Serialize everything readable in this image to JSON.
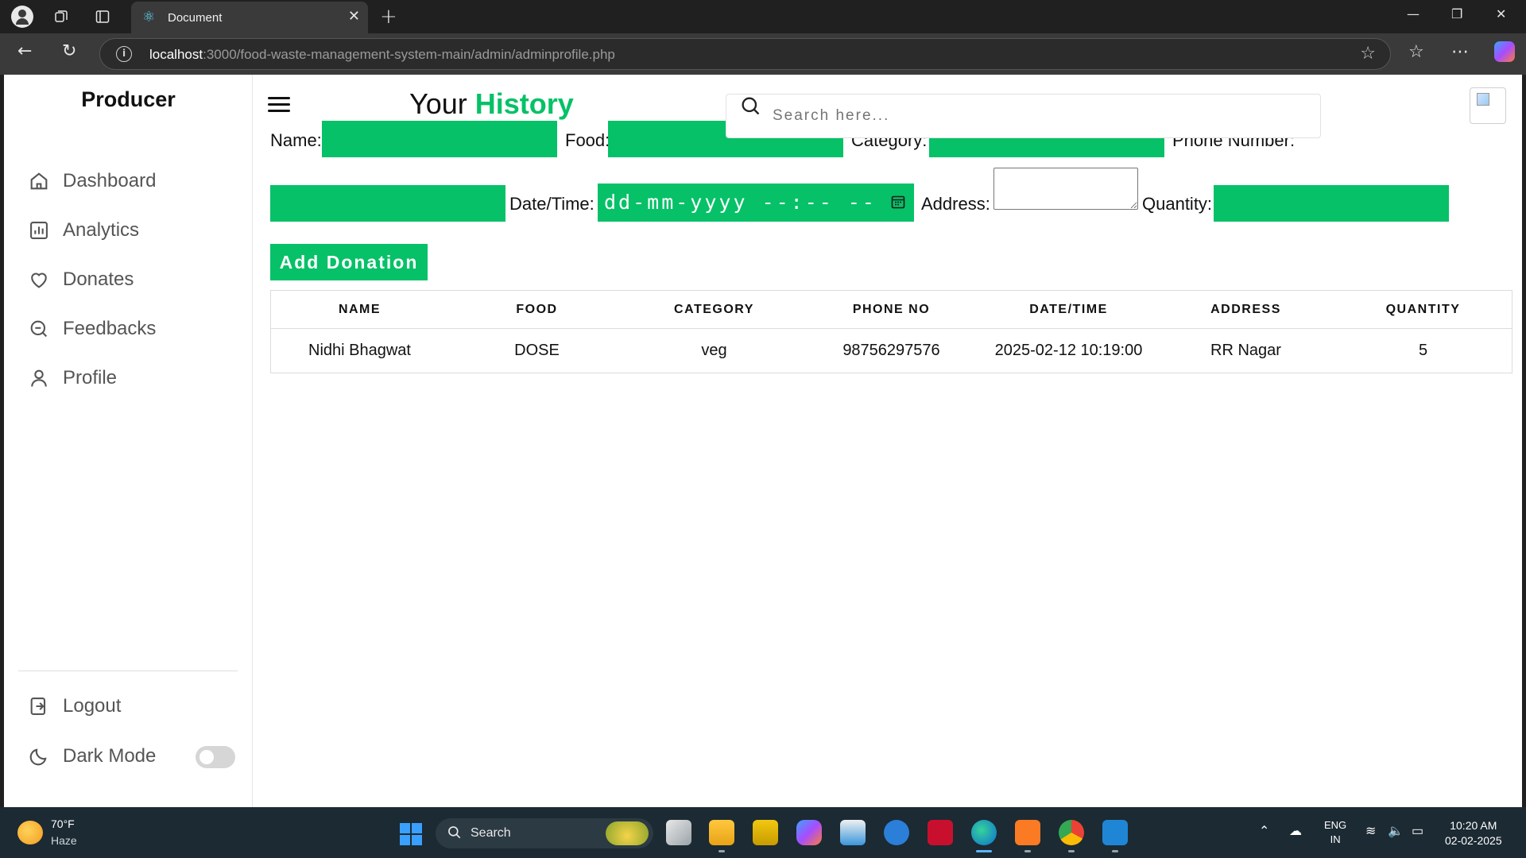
{
  "browser": {
    "tab_title": "Document",
    "url_host": "localhost",
    "url_path": ":3000/food-waste-management-system-main/admin/adminprofile.php"
  },
  "sidebar": {
    "brand": "Producer",
    "items": [
      {
        "label": "Dashboard",
        "icon": "home-icon"
      },
      {
        "label": "Analytics",
        "icon": "bar-chart-icon"
      },
      {
        "label": "Donates",
        "icon": "heart-icon"
      },
      {
        "label": "Feedbacks",
        "icon": "chat-icon"
      },
      {
        "label": "Profile",
        "icon": "user-icon"
      }
    ],
    "logout_label": "Logout",
    "dark_mode_label": "Dark Mode",
    "dark_mode_on": false
  },
  "header": {
    "title_prefix": "Your",
    "title_accent": "History",
    "search_placeholder": "Search here...",
    "accent_color": "#06c167"
  },
  "form": {
    "name_label": "Name:",
    "food_label": "Food:",
    "category_label": "Category:",
    "phone_label": "Phone Number:",
    "datetime_label": "Date/Time:",
    "datetime_placeholder": "dd-mm-yyyy --:-- --",
    "address_label": "Address:",
    "quantity_label": "Quantity:",
    "submit_label": "Add Donation"
  },
  "table": {
    "headers": [
      "NAME",
      "FOOD",
      "CATEGORY",
      "PHONE NO",
      "DATE/TIME",
      "ADDRESS",
      "QUANTITY"
    ],
    "rows": [
      [
        "Nidhi Bhagwat",
        "DOSE",
        "veg",
        "98756297576",
        "2025-02-12 10:19:00",
        "RR Nagar",
        "5"
      ]
    ]
  },
  "taskbar": {
    "weather_temp": "70°F",
    "weather_desc": "Haze",
    "search_label": "Search",
    "lang_1": "ENG",
    "lang_2": "IN",
    "time": "10:20 AM",
    "date": "02-02-2025"
  }
}
